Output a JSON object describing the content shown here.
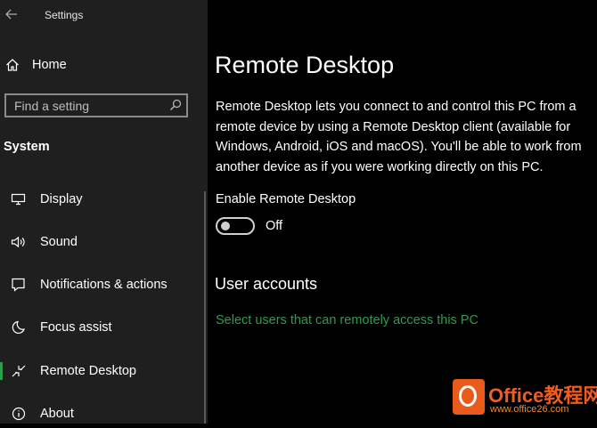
{
  "window": {
    "title": "Settings",
    "back_icon": "arrow-left-icon"
  },
  "sidebar": {
    "home_label": "Home",
    "home_icon": "home-icon",
    "search_placeholder": "Find a setting",
    "search_icon": "search-icon",
    "section_title": "System",
    "items": [
      {
        "label": "Display",
        "icon": "display-icon",
        "active": false
      },
      {
        "label": "Sound",
        "icon": "speaker-icon",
        "active": false
      },
      {
        "label": "Notifications & actions",
        "icon": "notification-icon",
        "active": false
      },
      {
        "label": "Focus assist",
        "icon": "moon-icon",
        "active": false
      },
      {
        "label": "Remote Desktop",
        "icon": "remote-desktop-icon",
        "active": true
      },
      {
        "label": "About",
        "icon": "info-icon",
        "active": false
      }
    ]
  },
  "main": {
    "title": "Remote Desktop",
    "description": "Remote Desktop lets you connect to and control this PC from a remote device by using a Remote Desktop client (available for Windows, Android, iOS and macOS). You'll be able to work from another device as if you were working directly on this PC.",
    "toggle_label": "Enable Remote Desktop",
    "toggle_state": "Off",
    "toggle_on": false,
    "section_title": "User accounts",
    "link_text": "Select users that can remotely access this PC"
  },
  "colors": {
    "accent": "#2e9e4a",
    "link": "#2f9b4a",
    "sidebar_bg": "#1f1f1f",
    "main_bg": "#000000"
  },
  "watermark": {
    "title": "Office教程网",
    "url": "www.office26.com"
  }
}
